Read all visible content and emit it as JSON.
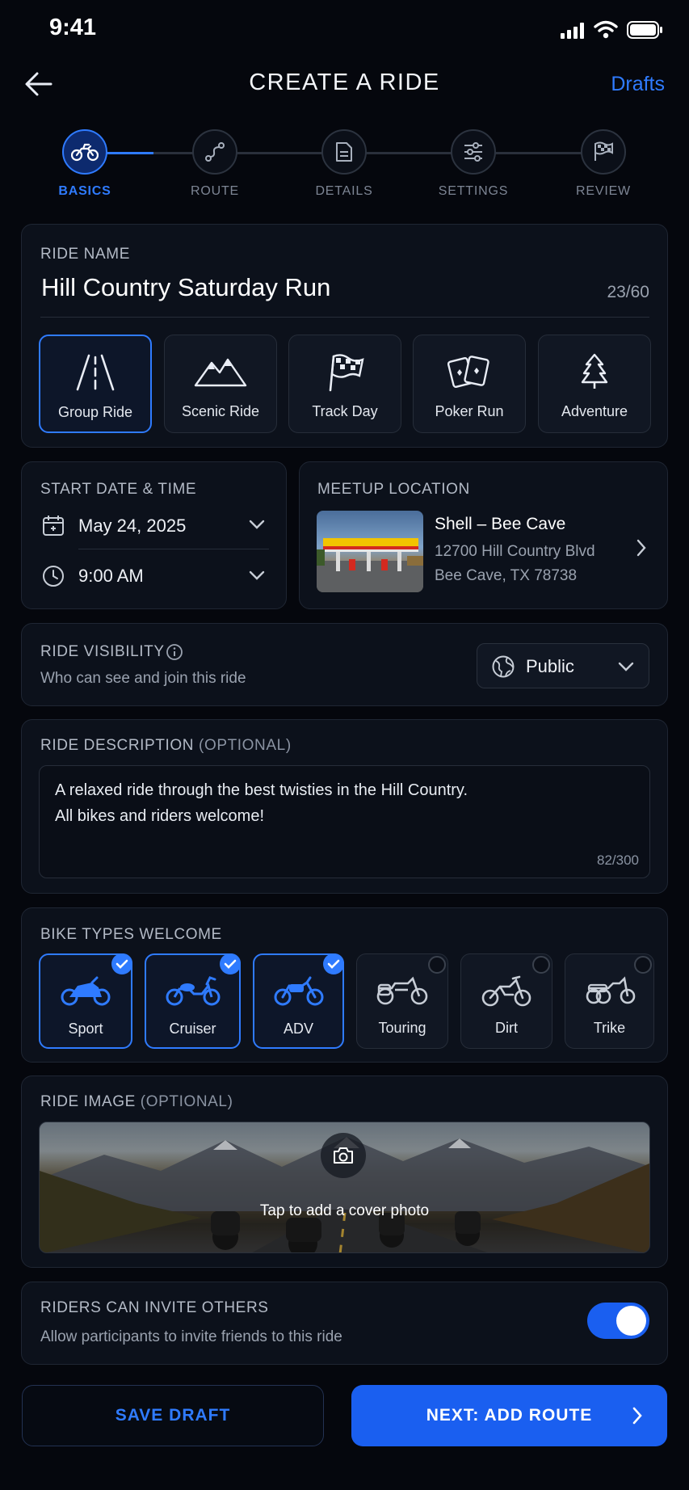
{
  "status_bar": {
    "time": "9:41"
  },
  "header": {
    "title": "CREATE A RIDE",
    "drafts_label": "Drafts"
  },
  "steps": [
    {
      "label": "BASICS",
      "icon": "motorcycle-icon",
      "active": true
    },
    {
      "label": "ROUTE",
      "icon": "route-icon",
      "active": false
    },
    {
      "label": "DETAILS",
      "icon": "document-icon",
      "active": false
    },
    {
      "label": "SETTINGS",
      "icon": "sliders-icon",
      "active": false
    },
    {
      "label": "REVIEW",
      "icon": "checkered-flag-icon",
      "active": false
    }
  ],
  "ride_name": {
    "label": "RIDE NAME",
    "value": "Hill Country Saturday Run",
    "counter": "23/60"
  },
  "ride_types": [
    {
      "label": "Group Ride",
      "icon": "road-icon",
      "selected": true
    },
    {
      "label": "Scenic Ride",
      "icon": "mountains-icon",
      "selected": false
    },
    {
      "label": "Track Day",
      "icon": "checkered-flag-icon",
      "selected": false
    },
    {
      "label": "Poker Run",
      "icon": "cards-icon",
      "selected": false
    },
    {
      "label": "Adventure",
      "icon": "tree-icon",
      "selected": false
    }
  ],
  "start": {
    "label": "START DATE & TIME",
    "date": "May 24, 2025",
    "time": "9:00 AM"
  },
  "meetup": {
    "label": "MEETUP LOCATION",
    "name": "Shell – Bee Cave",
    "address1": "12700 Hill Country Blvd",
    "address2": "Bee Cave, TX 78738"
  },
  "visibility": {
    "label": "RIDE VISIBILITY",
    "subtitle": "Who can see and join this ride",
    "value": "Public"
  },
  "description": {
    "label": "RIDE DESCRIPTION",
    "optional": "(OPTIONAL)",
    "line1": "A relaxed ride through the best twisties in the Hill Country.",
    "line2": "All bikes and riders welcome!",
    "counter": "82/300"
  },
  "bike_types": {
    "label": "BIKE TYPES WELCOME",
    "items": [
      {
        "label": "Sport",
        "selected": true
      },
      {
        "label": "Cruiser",
        "selected": true
      },
      {
        "label": "ADV",
        "selected": true
      },
      {
        "label": "Touring",
        "selected": false
      },
      {
        "label": "Dirt",
        "selected": false
      },
      {
        "label": "Trike",
        "selected": false
      }
    ]
  },
  "ride_image": {
    "label": "RIDE IMAGE",
    "optional": "(OPTIONAL)",
    "cta": "Tap to add a cover photo"
  },
  "invite": {
    "label": "RIDERS CAN INVITE OTHERS",
    "subtitle": "Allow participants to invite friends to this ride",
    "enabled": true
  },
  "footer": {
    "save_draft": "SAVE DRAFT",
    "next": "NEXT: ADD ROUTE"
  },
  "colors": {
    "accent": "#2f7bff",
    "background": "#05070d",
    "card": "#0c111b"
  }
}
